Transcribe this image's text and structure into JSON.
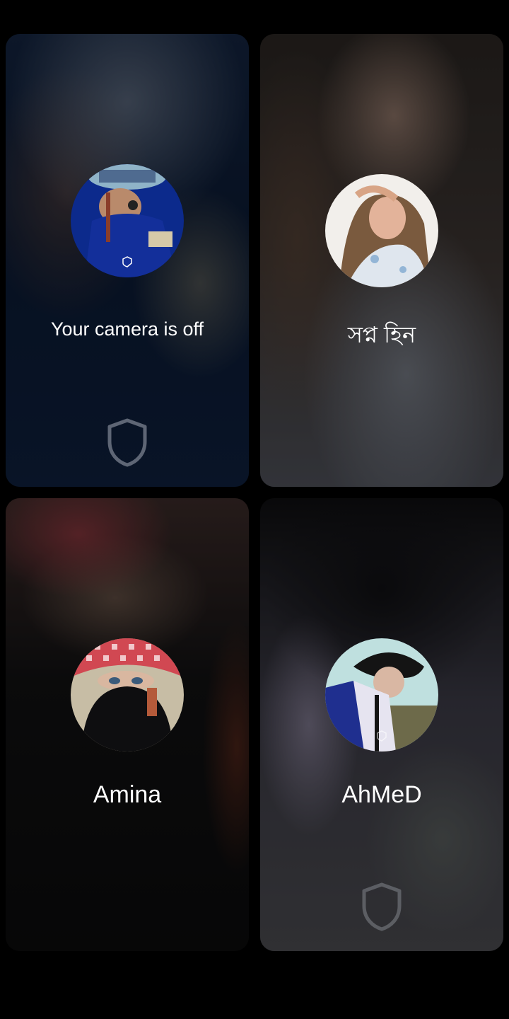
{
  "participants": [
    {
      "id": "self",
      "label": "Your camera is off",
      "camera_off": true,
      "verified_icon": "shield-icon",
      "accent": "#0a1d44"
    },
    {
      "id": "p2",
      "label": "সপ্ন হিন",
      "camera_off": false,
      "accent": "#d9c4b8"
    },
    {
      "id": "p3",
      "label": "Amina",
      "camera_off": false,
      "accent": "#c5323c"
    },
    {
      "id": "p4",
      "label": "AhMeD",
      "camera_off": false,
      "verified_icon": "shield-icon",
      "accent": "#2a2f7a"
    }
  ]
}
